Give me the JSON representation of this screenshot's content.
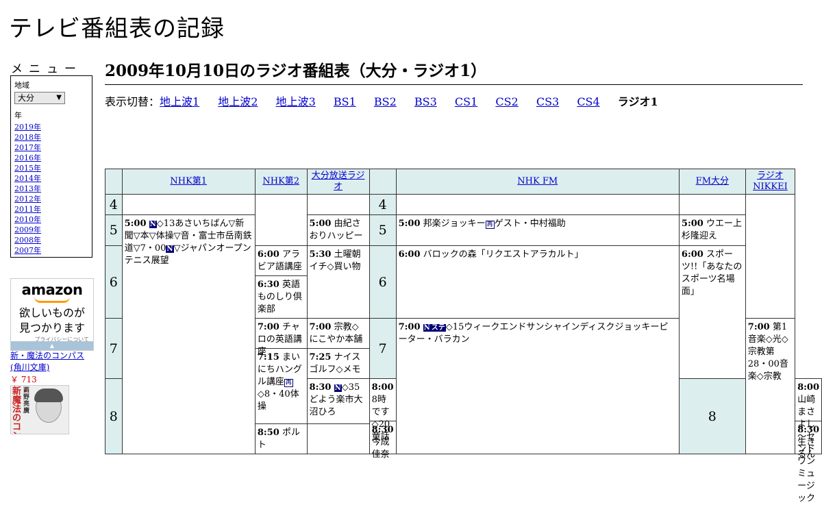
{
  "site": {
    "title": "テレビ番組表の記録"
  },
  "menu": {
    "heading": "メニュー",
    "region_label": "地域",
    "region_value": "大分",
    "year_label": "年",
    "years": [
      "2019年",
      "2018年",
      "2017年",
      "2016年",
      "2015年",
      "2014年",
      "2013年",
      "2012年",
      "2011年",
      "2010年",
      "2009年",
      "2008年",
      "2007年"
    ]
  },
  "ad": {
    "brand": "amazon",
    "copy_line1": "欲しいものが",
    "copy_line2": "見つかります",
    "privacy": "プライバシーについて",
    "book_title": "新・魔法のコンパス (角川文庫)",
    "book_price": "￥ 713",
    "cover_text": "新・魔法のコンパス",
    "cover_author": "西野亮廣"
  },
  "page": {
    "title": "2009年10月10日のラジオ番組表（大分・ラジオ1）",
    "switch_label": "表示切替：",
    "switch_links": [
      "地上波1",
      "地上波2",
      "地上波3",
      "BS1",
      "BS2",
      "BS3",
      "CS1",
      "CS2",
      "CS3",
      "CS4"
    ],
    "switch_current": "ラジオ1"
  },
  "grid": {
    "channels": [
      "NHK第1",
      "NHK第2",
      "大分放送ラジオ",
      "NHK FM",
      "FM大分",
      "ラジオNIKKEI"
    ],
    "hours": [
      "4",
      "5",
      "6",
      "7",
      "8"
    ],
    "programs": {
      "nhk1_0500_time": "5:00",
      "nhk1_0500_title": "◇13あさいちばん▽新聞▽本▽体操▽音・富士市岳南鉄道▽7・00",
      "nhk1_0500_title2": "▽ジャパンオープンテニス展望",
      "nhk1_0830_time": "8:30",
      "nhk1_0830_title": "◇35どよう楽市大沼ひろ",
      "nhk2_0600_time": "6:00",
      "nhk2_0600_title": "アラビア語講座",
      "nhk2_0630_time": "6:30",
      "nhk2_0630_title": "英語ものしり倶楽部",
      "nhk2_0700_time": "7:00",
      "nhk2_0700_title": "チャロの英語講座",
      "nhk2_0715_time": "7:15",
      "nhk2_0715_title": "まいにちハングル講座",
      "nhk2_0715_title2": "◇8・40体操",
      "nhk2_0850_time": "8:50",
      "nhk2_0850_title": "ポルト",
      "obs_0500_time": "5:00",
      "obs_0500_title": "由紀さおりハッピー",
      "obs_0530_time": "5:30",
      "obs_0530_title": "土曜朝イチ◇買い物",
      "obs_0700_time": "7:00",
      "obs_0700_title": "宗教◇にこやか本舗",
      "obs_0725_time": "7:25",
      "obs_0725_title": "ナイスゴルフ◇メモ",
      "obs_0800_time": "8:00",
      "obs_0800_title": "8時です◇20童話",
      "obs_0830_time": "8:30",
      "obs_0830_title": "今成佳奈",
      "fm_0500_time": "5:00",
      "fm_0500_title": "邦楽ジョッキー",
      "fm_0500_title2": "ゲスト・中村福助",
      "fm_0600_time": "6:00",
      "fm_0600_title": "バロックの森「リクエストアラカルト」",
      "fm_0700_time": "7:00",
      "fm_0700_title": "◇15ウィークエンドサンシャインディスクジョッキーピーター・バラカン",
      "fmo_0500_time": "5:00",
      "fmo_0500_title": "ウエー上杉隆迎え",
      "fmo_0600_time": "6:00",
      "fmo_0600_title": "スポーツ!!「あなたのスポーツ名場面」",
      "fmo_0800_time": "8:00",
      "fmo_0800_title": "山崎まさよし～センドワンミュージック",
      "fmo_0830_time": "8:30",
      "fmo_0830_title": "生きるん",
      "nikkei_0700_time": "7:00",
      "nikkei_0700_title": "第1音楽◇光◇宗教第28・00音楽◇宗教"
    },
    "marks": {
      "news": "N",
      "stereo": "ステ",
      "re": "再"
    }
  }
}
